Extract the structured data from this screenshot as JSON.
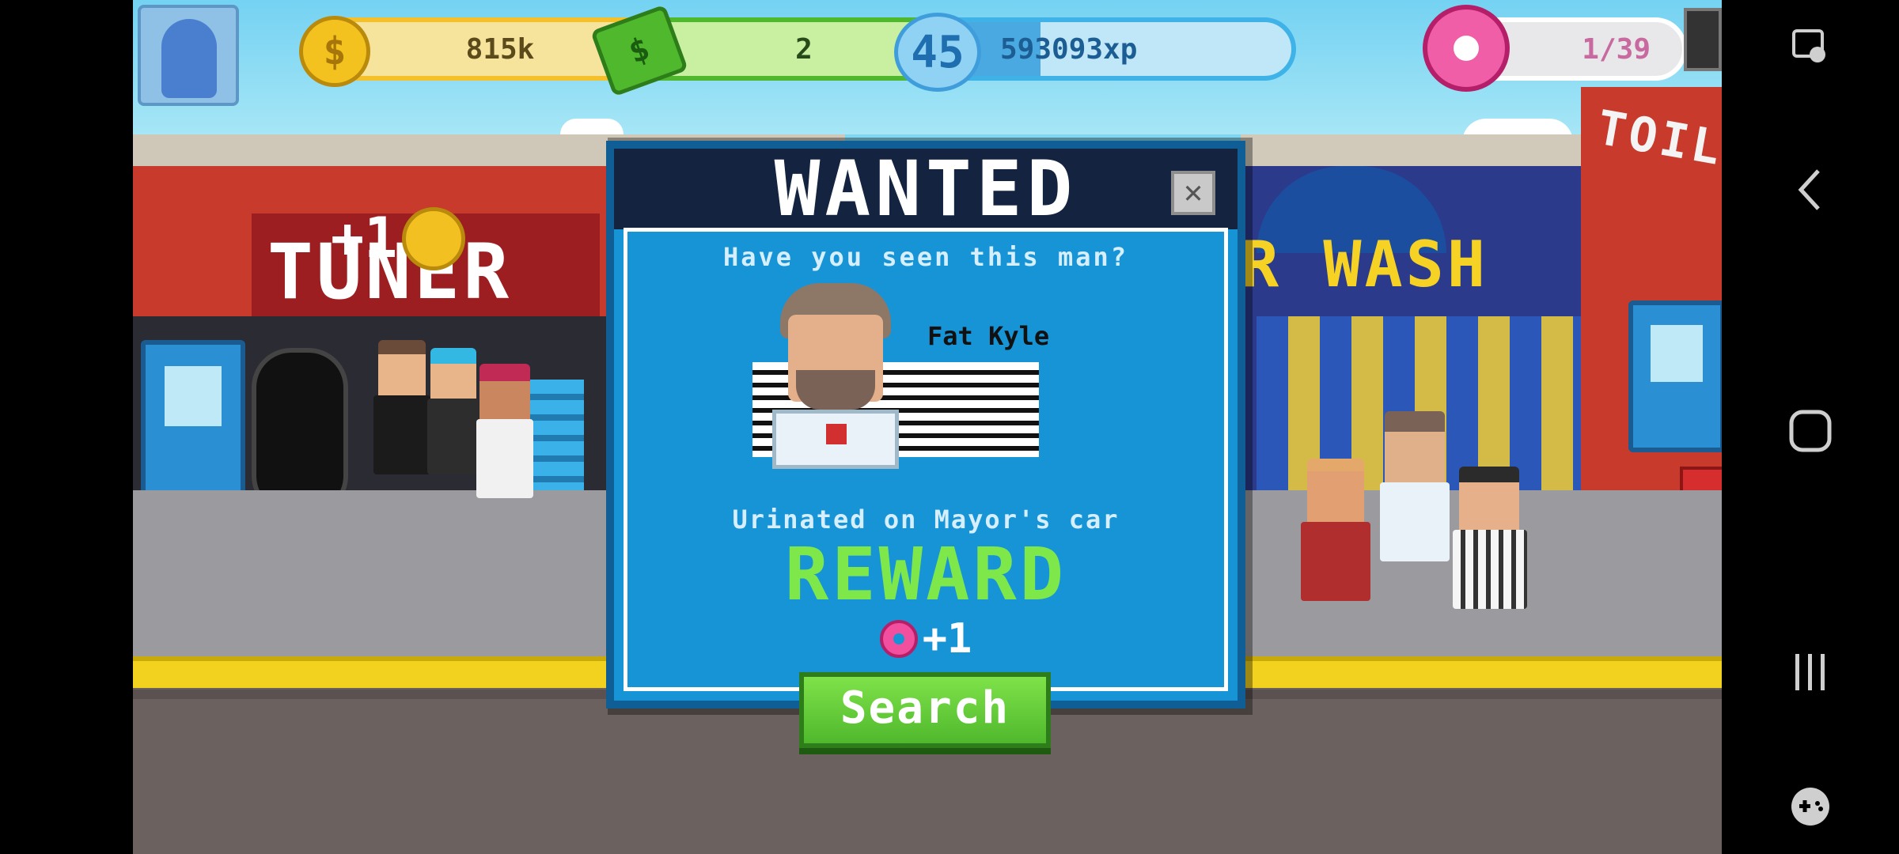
{
  "hud": {
    "coins": {
      "value": "815k",
      "icon": "dollar-coin-icon",
      "add": "+"
    },
    "cash": {
      "value": "2",
      "icon": "cash-bill-icon",
      "add": "+"
    },
    "level": {
      "level": "45",
      "xp": "593093xp",
      "progress": 0.35
    },
    "donuts": {
      "value": "1/39",
      "icon": "donut-icon"
    }
  },
  "scene": {
    "left_shop": "TUNER",
    "right_shop": "R WASH",
    "far_right_shop": "TOIL",
    "floating_coin_text": "+1"
  },
  "wanted": {
    "title": "WANTED",
    "close": "✕",
    "question": "Have you seen this man?",
    "name": "Fat Kyle",
    "crime": "Urinated on Mayor's car",
    "reward_label": "REWARD",
    "reward_amount": "+1",
    "search_button": "Search"
  },
  "colors": {
    "modal_bg": "#1794d6",
    "header_bg": "#142340",
    "reward_green": "#7ee84a",
    "search_green": "#5fc93a"
  }
}
